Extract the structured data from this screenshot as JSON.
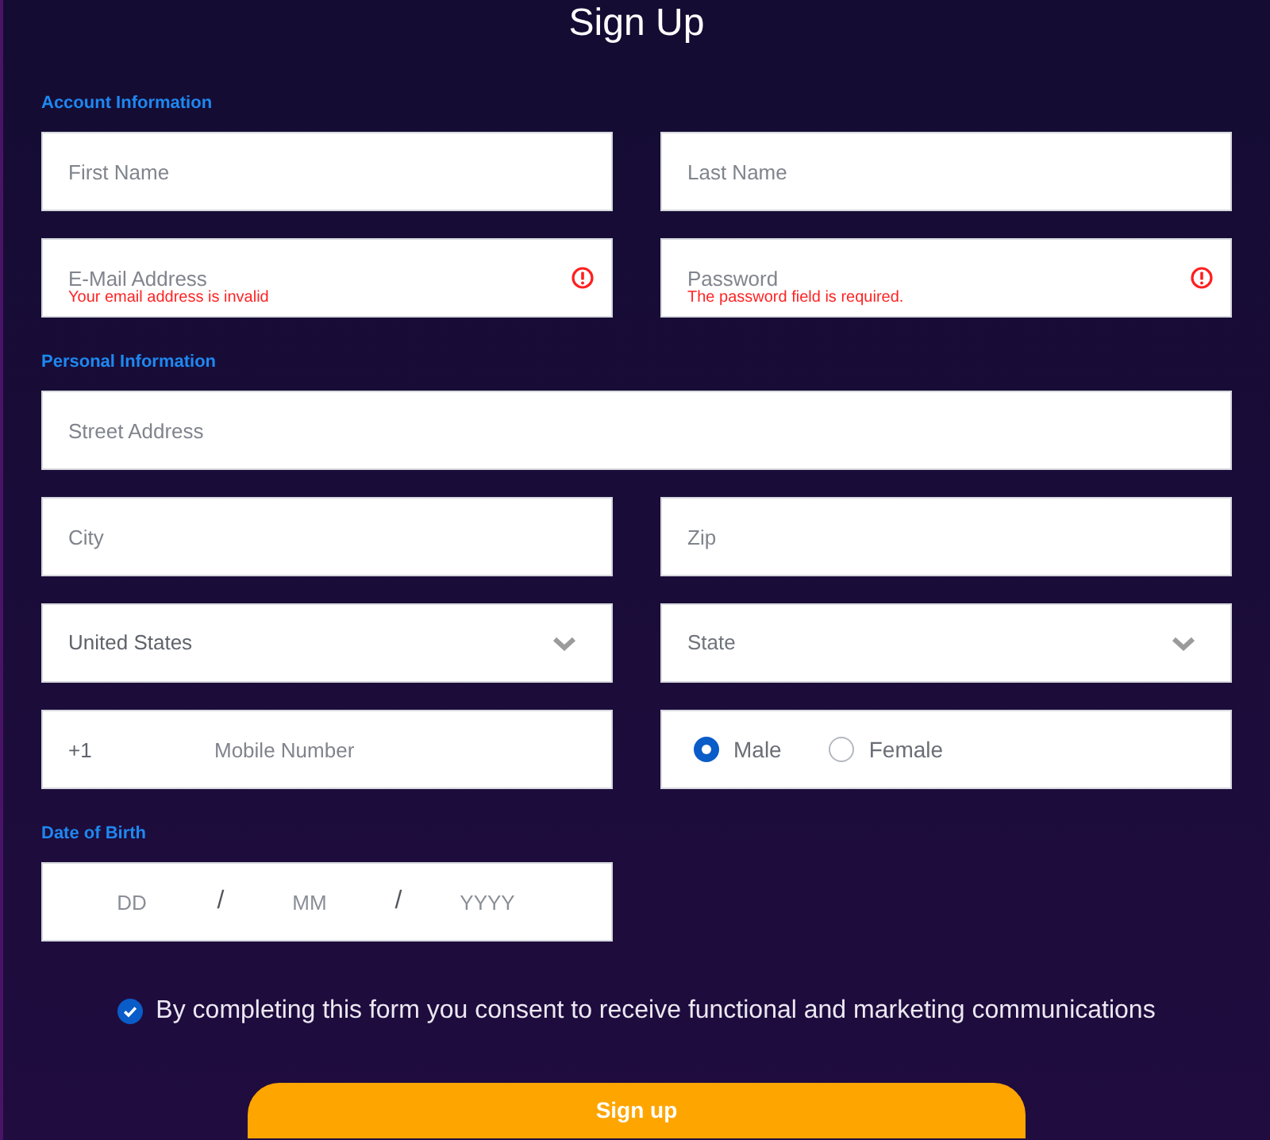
{
  "title": "Sign Up",
  "sections": [
    {
      "heading": "Account Information",
      "rows": [
        [
          {
            "kind": "text",
            "placeholder": "First Name"
          },
          {
            "kind": "text",
            "placeholder": "Last Name"
          }
        ],
        [
          {
            "kind": "text",
            "placeholder": "E-Mail Address",
            "error": "Your email address is invalid"
          },
          {
            "kind": "text",
            "placeholder": "Password",
            "error": "The password field is required."
          }
        ]
      ]
    },
    {
      "heading": "Personal Information",
      "rows": [
        [
          {
            "kind": "text",
            "placeholder": "Street Address"
          }
        ],
        [
          {
            "kind": "text",
            "placeholder": "City"
          },
          {
            "kind": "text",
            "placeholder": "Zip"
          }
        ],
        [
          {
            "kind": "select",
            "value": "United States"
          },
          {
            "kind": "select",
            "placeholder": "State"
          }
        ],
        [
          {
            "kind": "phone",
            "code": "+1",
            "placeholder": "Mobile Number"
          },
          {
            "kind": "radio",
            "options": [
              {
                "label": "Male",
                "selected": true
              },
              {
                "label": "Female",
                "selected": false
              }
            ]
          }
        ]
      ]
    },
    {
      "heading": "Date of Birth",
      "rows": [
        [
          {
            "kind": "date",
            "segments": [
              {
                "kind": "input",
                "placeholder": "DD"
              },
              {
                "kind": "separator",
                "text": "/"
              },
              {
                "kind": "input",
                "placeholder": "MM"
              },
              {
                "kind": "separator",
                "text": "/"
              },
              {
                "kind": "input",
                "placeholder": "YYYY"
              }
            ]
          }
        ]
      ]
    }
  ],
  "consent": {
    "checked": true,
    "text": "By completing this form you consent to receive functional and marketing communications"
  },
  "submit": {
    "label": "Sign up"
  }
}
